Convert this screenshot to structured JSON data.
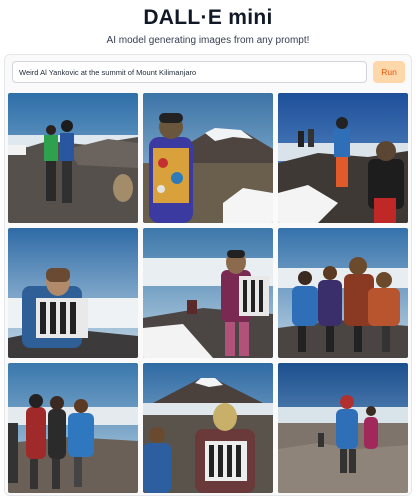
{
  "header": {
    "title": "DALL·E mini",
    "subtitle": "AI model generating images from any prompt!"
  },
  "prompt": {
    "value": "Weird Al Yankovic at the summit of Mount Kilimanjaro",
    "run_label": "Run"
  },
  "colors": {
    "run_bg": "#fed7aa",
    "run_text": "#ea580c"
  },
  "images": [
    {
      "name": "generated-image-1"
    },
    {
      "name": "generated-image-2"
    },
    {
      "name": "generated-image-3"
    },
    {
      "name": "generated-image-4"
    },
    {
      "name": "generated-image-5"
    },
    {
      "name": "generated-image-6"
    },
    {
      "name": "generated-image-7"
    },
    {
      "name": "generated-image-8"
    },
    {
      "name": "generated-image-9"
    }
  ]
}
